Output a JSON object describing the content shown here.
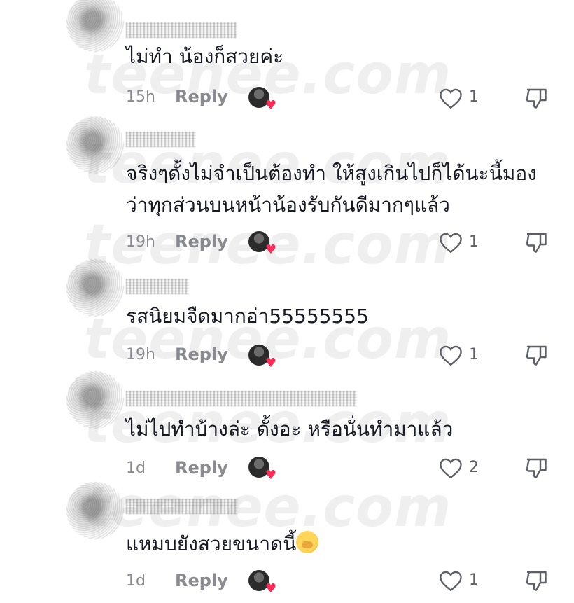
{
  "watermark": "teenee.com",
  "comments": [
    {
      "text": "ไม่ทำ น้องก็สวยค่ะ",
      "time": "15h",
      "reply": "Reply",
      "likes": "1"
    },
    {
      "text": "จริงๆดั้งไม่จำเป็นต้องทำ ให้สูงเกินไปก็ได้นะนี้มองว่าทุกส่วนบนหน้าน้องรับกันดีมากๆแล้ว",
      "time": "19h",
      "reply": "Reply",
      "likes": "1"
    },
    {
      "text": "รสนิยมจืดมากอ่า55555555",
      "time": "19h",
      "reply": "Reply",
      "likes": "1"
    },
    {
      "text": "ไม่ไปทำบ้างล่ะ ดั้งอะ หรือนั่นทำมาแล้ว",
      "time": "1d",
      "reply": "Reply",
      "likes": "2"
    },
    {
      "text": "แหมบยังสวยขนาดนี้",
      "time": "1d",
      "reply": "Reply",
      "likes": "1"
    }
  ],
  "colors": {
    "text": "#161823",
    "meta": "#8a8b91",
    "heart": "#fe2c55"
  },
  "icons": {
    "like": "heart-outline-icon",
    "dislike": "thumbs-down-outline-icon",
    "emoji": "face-with-hand-over-mouth"
  }
}
